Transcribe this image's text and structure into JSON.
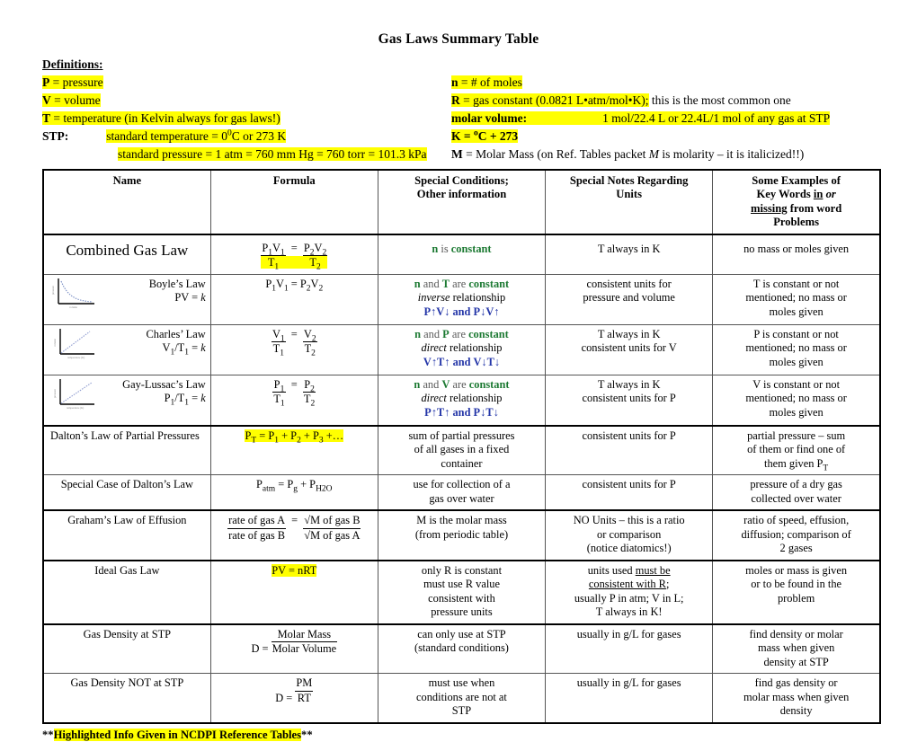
{
  "document": {
    "title": "Gas Laws Summary Table",
    "definitions_heading": "Definitions:",
    "footnote_prefix": "**",
    "footnote_highlight": "Highlighted Info Given in NCDPI Reference Tables",
    "footnote_suffix": "**"
  },
  "colors": {
    "highlight": "#ffff00",
    "green": "#1d7a33",
    "blue": "#2436a8",
    "gray": "#5a5a5a"
  },
  "definitions": {
    "left": [
      {
        "symbol": "P",
        "text": " = pressure",
        "highlighted": true
      },
      {
        "symbol": "V",
        "text": " = volume",
        "highlighted": true
      },
      {
        "symbol": "T",
        "text": " = temperature (in Kelvin always for gas laws!)",
        "highlighted": true
      },
      {
        "symbol": "STP:",
        "text": "standard temperature = 0°C or 273 K",
        "highlighted": true
      },
      {
        "symbol": "",
        "text": "standard pressure = 1 atm = 760 mm Hg = 760 torr = 101.3 kPa",
        "highlighted": true
      }
    ],
    "right": [
      {
        "symbol": "n",
        "text": " = # of moles",
        "highlighted": true
      },
      {
        "symbol": "R",
        "text_hl": " = gas constant (0.0821 L•atm/mol•K);",
        "text_plain": " this is the most common one"
      },
      {
        "symbol": "molar volume:",
        "text": "1 mol/22.4 L   or   22.4L/1 mol of any gas at STP",
        "highlighted": true
      },
      {
        "symbol": "K = °C + 273",
        "text": "",
        "highlighted": true
      },
      {
        "symbol": "M",
        "text": " = Molar Mass (on Ref. Tables packet M is molarity – it is italicized!!)",
        "highlighted": false
      }
    ]
  },
  "table": {
    "headers": [
      "Name",
      "Formula",
      "Special Conditions;\nOther information",
      "Special Notes Regarding\nUnits",
      "Some Examples of Key Words in or missing from word Problems"
    ],
    "header_key_parts": [
      "Some Examples of",
      "Key Words ",
      "in ",
      "or",
      "missing",
      " from word",
      "Problems"
    ],
    "rows": [
      {
        "name": "Combined Gas Law",
        "name_style": "large",
        "thumbnail": null,
        "formula": {
          "type": "fraction-eq",
          "num1": "P₁V₁",
          "den1": "T₁",
          "num2": "P₂V₂",
          "den2": "T₂",
          "highlighted": true
        },
        "conditions": [
          {
            "text": "n is constant",
            "style": "green-n"
          }
        ],
        "units": [
          "T always in K"
        ],
        "keywords": [
          "no mass or moles given"
        ]
      },
      {
        "name": "Boyle’s Law",
        "name_sub": "PV = k",
        "name_style": "right",
        "thumbnail": "curve-decreasing",
        "formula": {
          "type": "plain",
          "text": "P₁V₁ = P₂V₂",
          "highlighted": false
        },
        "conditions": [
          {
            "text": "n and T are constant",
            "style": "mixed-green"
          },
          {
            "text": "inverse relationship",
            "style": "italic-first"
          },
          {
            "text": "P↑V↓ and P↓V↑",
            "style": "blue"
          }
        ],
        "units": [
          "consistent units for",
          "pressure and volume"
        ],
        "keywords": [
          "T is constant or not",
          "mentioned; no mass or",
          "moles given"
        ]
      },
      {
        "name": "Charles’ Law",
        "name_sub": "V₁/T₁ = k",
        "name_style": "right",
        "thumbnail": "line-increasing",
        "formula": {
          "type": "fraction-eq",
          "num1": "V₁",
          "den1": "T₁",
          "num2": "V₂",
          "den2": "T₂",
          "highlighted": false
        },
        "conditions": [
          {
            "text": "n and P are constant",
            "style": "mixed-green"
          },
          {
            "text": "direct relationship",
            "style": "italic-first"
          },
          {
            "text": "V↑T↑ and V↓T↓",
            "style": "blue"
          }
        ],
        "units": [
          "T always in K",
          "consistent units for V"
        ],
        "keywords": [
          "P is constant or not",
          "mentioned; no mass or",
          "moles given"
        ]
      },
      {
        "name": "Gay-Lussac’s Law",
        "name_sub": "P₁/T₁ = k",
        "name_style": "right",
        "thumbnail": "line-increasing",
        "formula": {
          "type": "fraction-eq",
          "num1": "P₁",
          "den1": "T₁",
          "num2": "P₂",
          "den2": "T₂",
          "highlighted": false
        },
        "conditions": [
          {
            "text": "n and V are constant",
            "style": "mixed-green"
          },
          {
            "text": "direct relationship",
            "style": "italic-first"
          },
          {
            "text": "P↑T↑ and P↓T↓",
            "style": "blue"
          }
        ],
        "units": [
          "T always in K",
          "consistent units for P"
        ],
        "keywords": [
          "V is constant or not",
          "mentioned; no mass or",
          "moles given"
        ]
      },
      {
        "name": "Dalton’s Law of Partial Pressures",
        "name_style": "normal",
        "thumbnail": null,
        "formula": {
          "type": "plain",
          "text": "Pт = P₁ + P₂ + P₃ +…",
          "highlighted": true
        },
        "conditions": [
          "sum of partial pressures",
          "of all gases in a fixed",
          "container"
        ],
        "units": [
          "consistent units for P"
        ],
        "keywords": [
          "partial pressure – sum",
          "of them or find one of",
          "them given Pт"
        ]
      },
      {
        "name": "Special Case of Dalton’s Law",
        "name_style": "normal",
        "thumbnail": null,
        "formula": {
          "type": "plain",
          "text": "Pₐₜₘ = P₍₎ + Pₕ₂ₒ",
          "highlighted": false
        },
        "conditions": [
          "use for collection of a",
          "gas over water"
        ],
        "units": [
          "consistent units for P"
        ],
        "keywords": [
          "pressure of a dry gas",
          "collected over water"
        ]
      },
      {
        "name": "Graham’s Law of Effusion",
        "name_style": "normal",
        "thumbnail": null,
        "formula": {
          "type": "fraction-eq",
          "num1": "rate of gas A",
          "den1": "rate of gas B",
          "num2": "√M of gas B",
          "den2": "√M of gas A",
          "highlighted": false
        },
        "conditions": [
          "M is the molar mass",
          "(from periodic table)"
        ],
        "units": [
          "NO Units – this is a ratio",
          "or comparison",
          "(notice diatomics!)"
        ],
        "keywords": [
          "ratio of speed, effusion,",
          "diffusion; comparison of",
          "2 gases"
        ]
      },
      {
        "name": "Ideal Gas Law",
        "name_style": "normal",
        "thumbnail": null,
        "formula": {
          "type": "plain",
          "text": "PV = nRT",
          "highlighted": true
        },
        "conditions": [
          "only R is constant",
          "must use R value",
          "consistent with",
          "pressure units"
        ],
        "units": [
          "units used must be",
          "consistent with R;",
          "usually P in atm;  V in L;",
          "T always in K!"
        ],
        "keywords": [
          "moles or mass is given",
          "or to be found in the",
          "problem"
        ]
      },
      {
        "name": "Gas Density at STP",
        "name_style": "normal",
        "thumbnail": null,
        "formula": {
          "type": "frac-labeled",
          "lead": "D = ",
          "num": "Molar Mass",
          "den": "Molar Volume",
          "highlighted": false
        },
        "conditions": [
          "can only use at STP",
          "(standard conditions)"
        ],
        "units": [
          "usually in g/L for gases"
        ],
        "keywords": [
          "find density or molar",
          "mass when given",
          "density at STP"
        ]
      },
      {
        "name": "Gas Density NOT at STP",
        "name_style": "normal",
        "thumbnail": null,
        "formula": {
          "type": "frac-labeled",
          "lead": "D = ",
          "num": "PM",
          "den": "RT",
          "highlighted": false
        },
        "conditions": [
          "must use when",
          "conditions are not at",
          "STP"
        ],
        "units": [
          "usually in g/L for gases"
        ],
        "keywords": [
          "find gas density or",
          "molar mass when given",
          "density"
        ]
      }
    ]
  }
}
